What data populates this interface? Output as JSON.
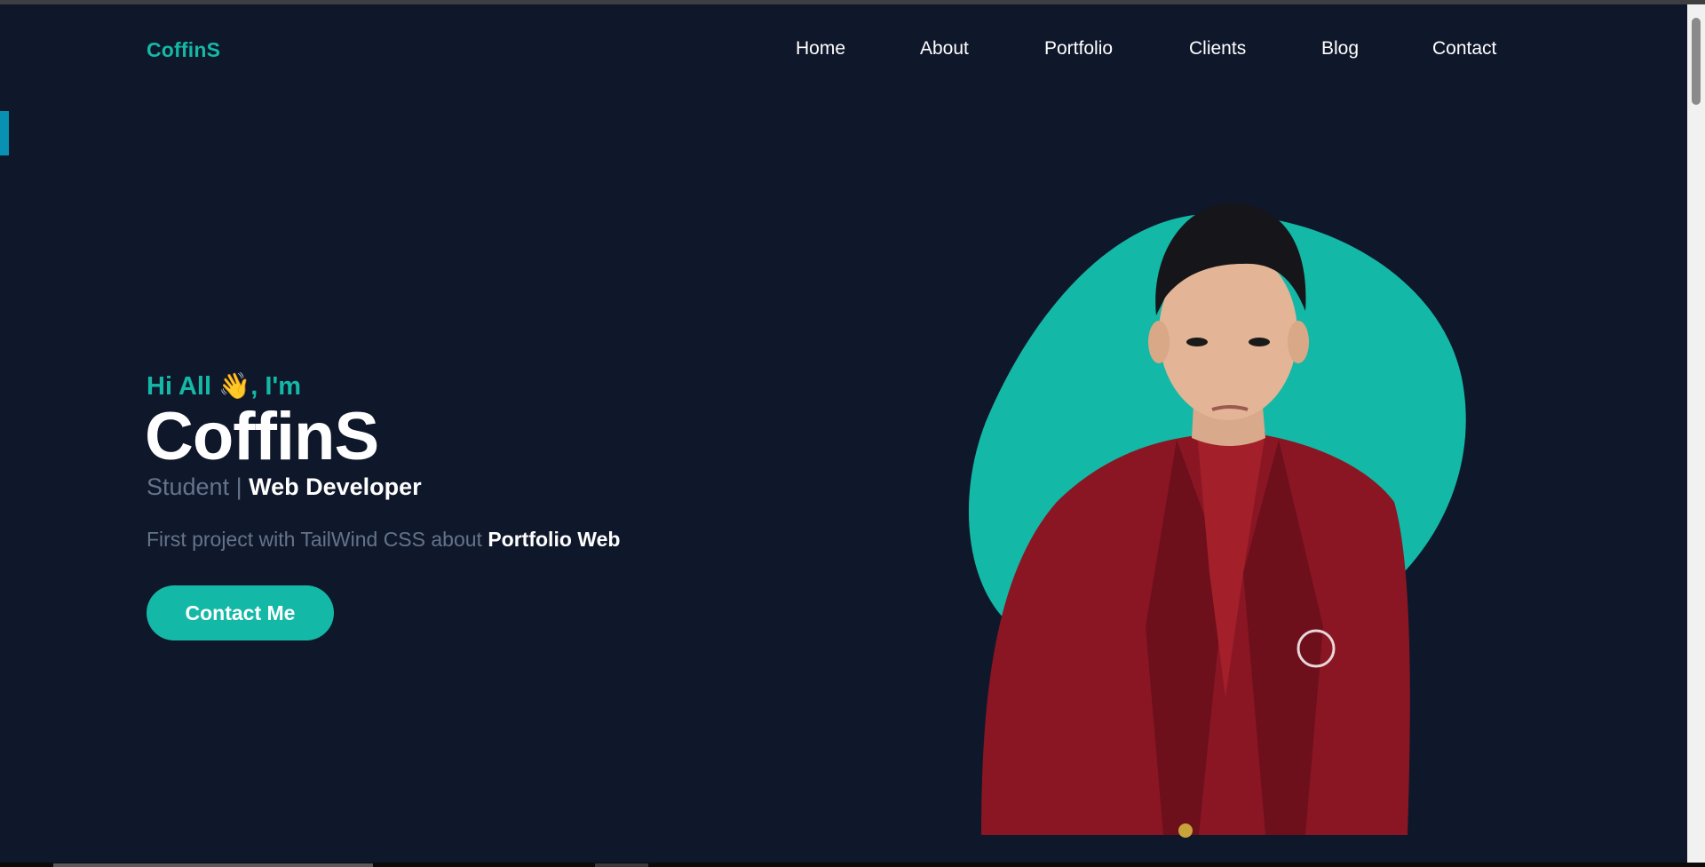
{
  "brand": {
    "logo": "CoffinS",
    "accent_color": "#14b8a6",
    "background_color": "#0f172a"
  },
  "nav": {
    "items": [
      "Home",
      "About",
      "Portfolio",
      "Clients",
      "Blog",
      "Contact"
    ]
  },
  "hero": {
    "greeting_prefix": "Hi All ",
    "greeting_emoji": "👋",
    "greeting_suffix": ", I'm",
    "name": "CoffinS",
    "role_prefix": "Student | ",
    "role_strong": "Web Developer",
    "description_prefix": "First project with TailWind CSS about ",
    "description_strong": "Portfolio Web",
    "cta_label": "Contact Me",
    "image_icon": "profile-photo",
    "blob_color": "#14b8a6"
  }
}
